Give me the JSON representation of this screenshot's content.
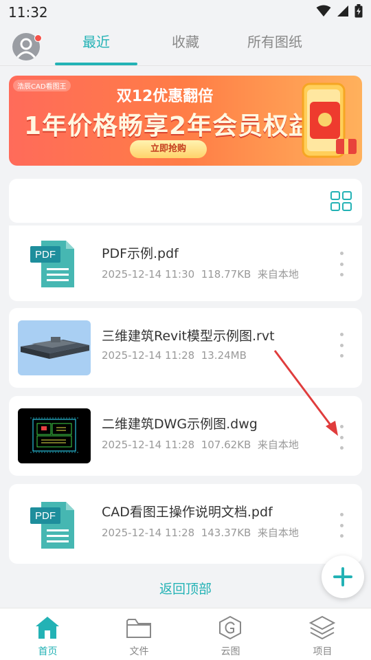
{
  "status": {
    "time": "11:32"
  },
  "header": {
    "tabs": [
      {
        "label": "最近",
        "active": true
      },
      {
        "label": "收藏",
        "active": false
      },
      {
        "label": "所有图纸",
        "active": false
      }
    ]
  },
  "banner": {
    "logo": "浩辰CAD看图王",
    "subtitle": "双12优惠翻倍",
    "headline": "1年价格畅享2年会员权益",
    "cta": "立即抢购"
  },
  "files": [
    {
      "name": "PDF示例.pdf",
      "date": "2025-12-14 11:30",
      "size": "118.77KB",
      "source": "来自本地",
      "thumb": "pdf"
    },
    {
      "name": "三维建筑Revit模型示例图.rvt",
      "date": "2025-12-14 11:28",
      "size": "13.24MB",
      "source": "",
      "thumb": "3d"
    },
    {
      "name": "二维建筑DWG示例图.dwg",
      "date": "2025-12-14 11:28",
      "size": "107.62KB",
      "source": "来自本地",
      "thumb": "dwg"
    },
    {
      "name": "CAD看图王操作说明文档.pdf",
      "date": "2025-12-14 11:28",
      "size": "143.37KB",
      "source": "来自本地",
      "thumb": "pdf"
    }
  ],
  "back_to_top": "返回顶部",
  "pdf_label": "PDF",
  "nav": [
    {
      "label": "首页",
      "icon": "home-icon",
      "active": true
    },
    {
      "label": "文件",
      "icon": "folder-icon",
      "active": false
    },
    {
      "label": "云图",
      "icon": "cloud-g-icon",
      "active": false
    },
    {
      "label": "项目",
      "icon": "layers-icon",
      "active": false
    }
  ],
  "colors": {
    "accent": "#23b2b5",
    "background": "#f2f3f5",
    "annotation": "#e03c3c"
  }
}
